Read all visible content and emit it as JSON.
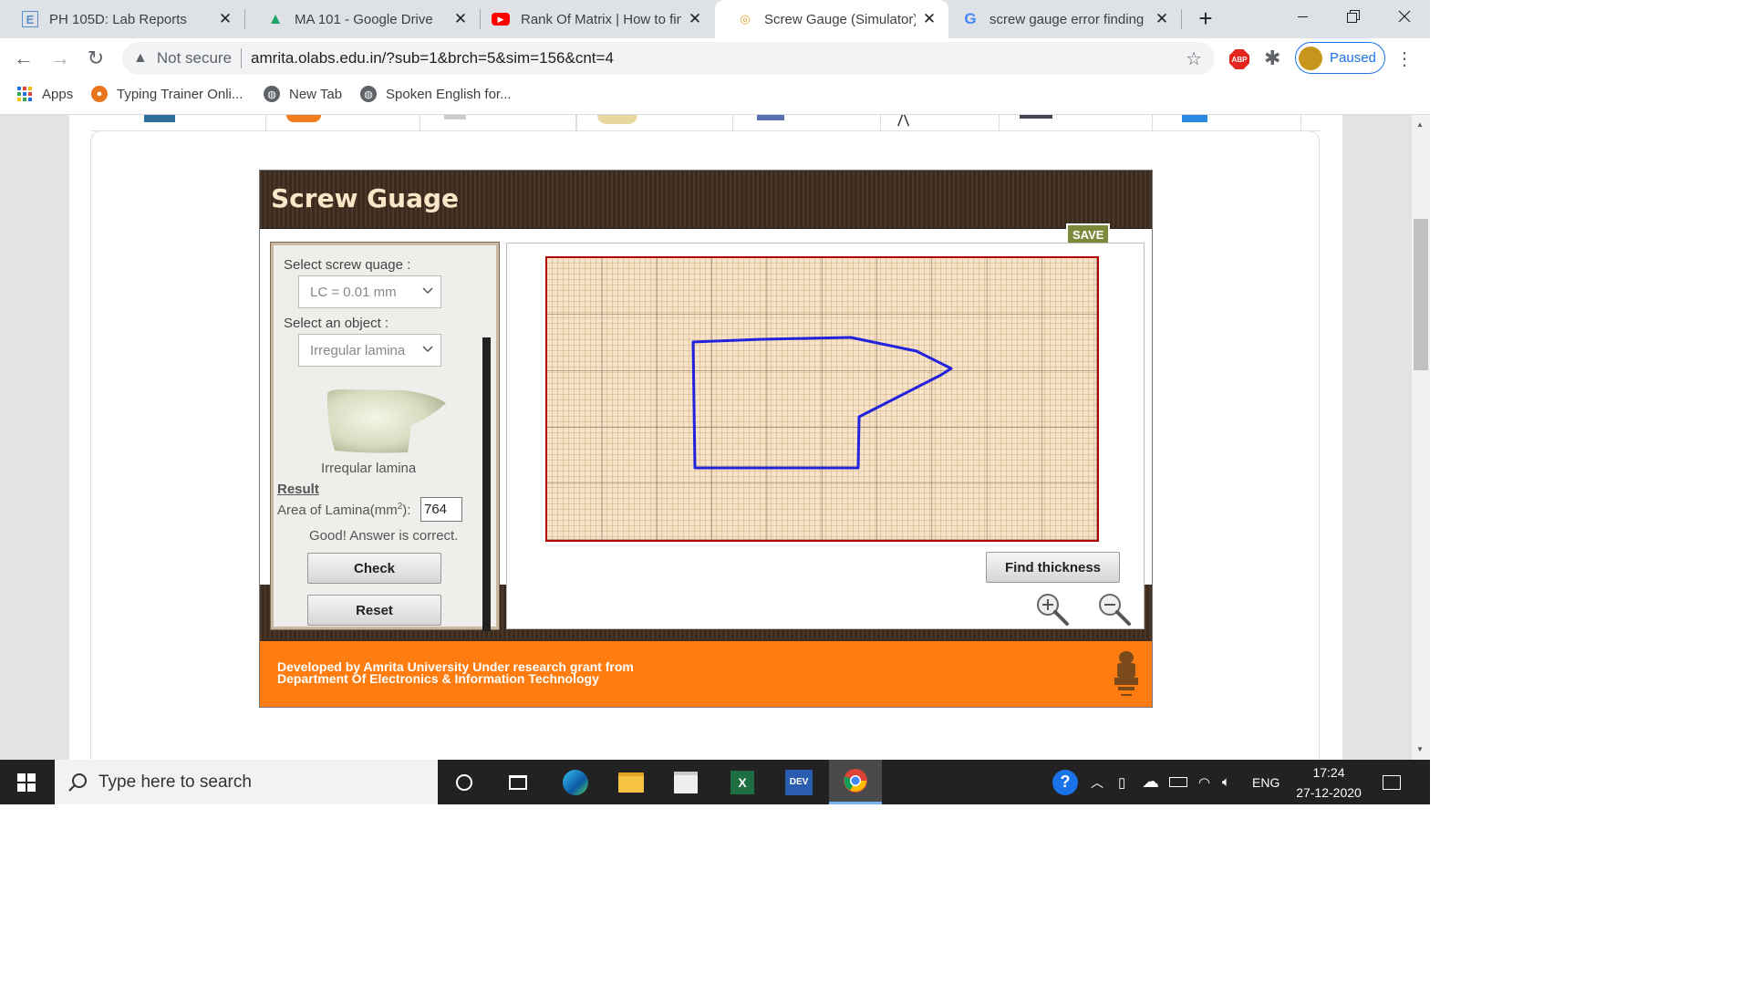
{
  "browser": {
    "tabs": [
      {
        "title": "PH 105D: Lab Reports",
        "favicon": "E",
        "icon": "letter-e-icon",
        "active": false
      },
      {
        "title": "MA 101 - Google Drive",
        "favicon": "▲",
        "icon": "google-drive-icon",
        "active": false
      },
      {
        "title": "Rank Of Matrix | How to fin",
        "favicon": "▶",
        "icon": "youtube-icon",
        "active": false
      },
      {
        "title": "Screw Gauge (Simulator) : C",
        "favicon": "◎",
        "icon": "olabs-icon",
        "active": true
      },
      {
        "title": "screw gauge error finding -",
        "favicon": "G",
        "icon": "google-icon",
        "active": false
      }
    ],
    "close_glyph": "✕",
    "new_tab_glyph": "+",
    "security_label": "Not secure",
    "url": "amrita.olabs.edu.in/?sub=1&brch=5&sim=156&cnt=4",
    "profile_label": "Paused",
    "abp_label": "ABP",
    "bookmarks": [
      {
        "label": "Apps",
        "icon": "apps-grid-icon"
      },
      {
        "label": "Typing Trainer Onli...",
        "icon": "typing-trainer-icon"
      },
      {
        "label": "New Tab",
        "icon": "globe-icon"
      },
      {
        "label": "Spoken English for...",
        "icon": "globe-icon"
      }
    ]
  },
  "sim": {
    "title": "Screw Guage",
    "save_label": "SAVE",
    "select_gauge_label": "Select screw quage :",
    "gauge_value": "LC = 0.01 mm",
    "select_object_label": "Select an object :",
    "object_value": "Irregular lamina",
    "object_caption": "Irreqular lamina",
    "result_heading": "Result",
    "area_label_prefix": "Area of Lamina(mm",
    "area_label_sup": "2",
    "area_label_suffix": "):",
    "area_value": "764",
    "feedback": "Good! Answer is correct.",
    "check_label": "Check",
    "reset_label": "Reset",
    "find_thickness_label": "Find thickness",
    "footer_line1": "Developed by Amrita University Under research grant from",
    "footer_line2": "Department Of Electronics & Information Technology"
  },
  "taskbar": {
    "search_placeholder": "Type here to search",
    "language": "ENG",
    "time": "17:24",
    "date": "27-12-2020",
    "dev_label": "DEV"
  },
  "colors": {
    "accent_orange": "#ff7d10",
    "header_brown": "#3d2e22",
    "grid_border": "#b30000",
    "lamina_outline": "#2222dd"
  }
}
